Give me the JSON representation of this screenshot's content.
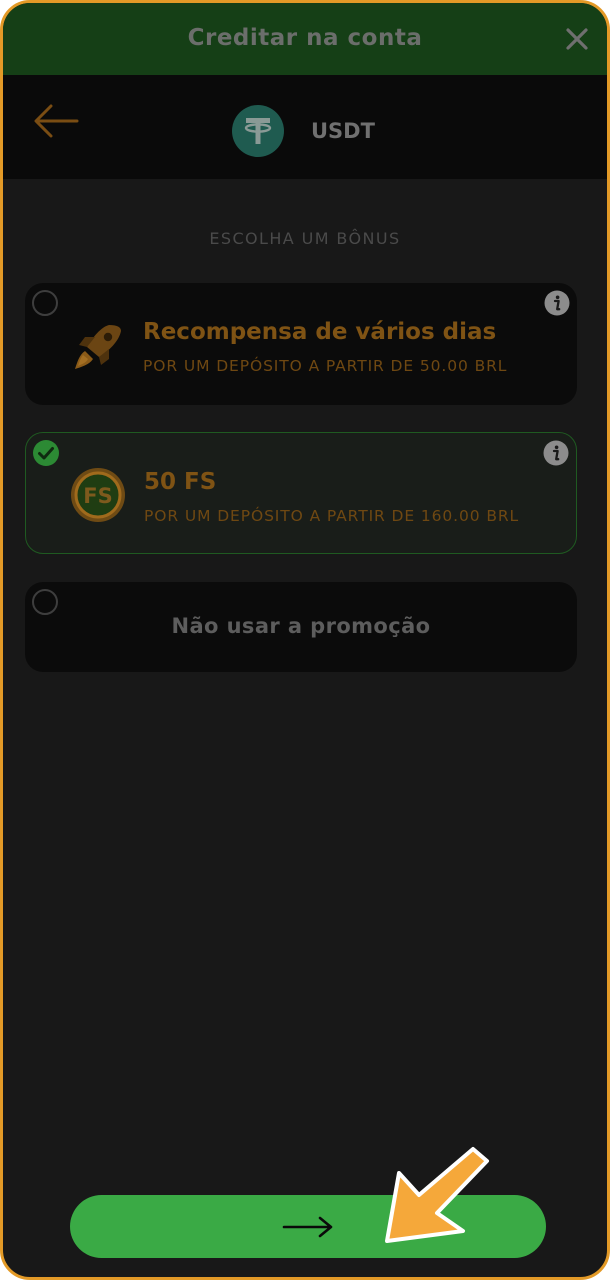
{
  "header": {
    "title": "Creditar na conta",
    "close_icon": "close-icon"
  },
  "subheader": {
    "back_icon": "arrow-left-icon",
    "currency_icon": "tether-icon",
    "currency": "USDT"
  },
  "bonus_section": {
    "label": "ESCOLHA UM BÔNUS",
    "options": [
      {
        "title": "Recompensa de vários dias",
        "subtitle": "POR UM DEPÓSITO A PARTIR DE 50.00 BRL",
        "icon": "rocket-icon",
        "selected": false
      },
      {
        "title": "50 FS",
        "subtitle": "POR UM DEPÓSITO A PARTIR DE 160.00 BRL",
        "icon": "free-spins-coin-icon",
        "selected": true
      },
      {
        "title": "Não usar a promoção",
        "selected": false
      }
    ]
  },
  "coin_fs_text": "FS",
  "continue_button": {
    "icon": "arrow-right-icon"
  },
  "colors": {
    "frame_border": "#e39a27",
    "header_bg": "#153f16",
    "accent_green": "#3aaa45",
    "bonus_text": "#7f5314",
    "pointer": "#f5a83a"
  }
}
